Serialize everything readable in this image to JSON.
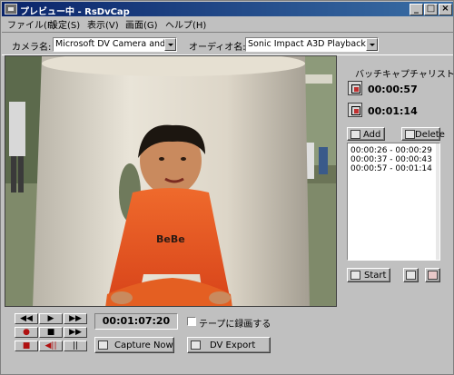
{
  "window": {
    "title": "プレビュー中 - RsDvCap",
    "minimize_glyph": "_",
    "maximize_glyph": "□",
    "close_glyph": "×"
  },
  "menu": [
    "ファイル(F)",
    "設定(S)",
    "表示(V)",
    "画面(G)",
    "ヘルプ(H)"
  ],
  "toolbar": {
    "camera_label": "カメラ名:",
    "camera_value": "Microsoft DV Camera and VCR",
    "audio_label": "オーディオ名:",
    "audio_value": "Sonic Impact A3D Playback"
  },
  "batch": {
    "title": "バッチキャプチャリスト",
    "in_time": "00:00:57",
    "out_time": "00:01:14",
    "in_icon": "mark-in-icon",
    "out_icon": "mark-out-icon",
    "add_label": "Add",
    "delete_label": "Delete",
    "list": [
      "00:00:26 - 00:00:29",
      "00:00:37 - 00:00:43",
      "00:00:57 - 00:01:14"
    ],
    "start_label": "Start"
  },
  "transport": {
    "glyphs": [
      "◀◀",
      "▶",
      "▶▶",
      "●",
      "■",
      "▶▶",
      "■",
      "◀||",
      "||"
    ]
  },
  "timecode": "00:01:07:20",
  "record_to_tape_label": "テープに録画する",
  "capture_now_label": "Capture Now",
  "dv_export_label": "DV Export",
  "colors": {
    "titlebar_start": "#0a246a",
    "titlebar_end": "#3a6ea5",
    "window_bg": "#c0c0c0",
    "shirt": "#e5521d"
  }
}
